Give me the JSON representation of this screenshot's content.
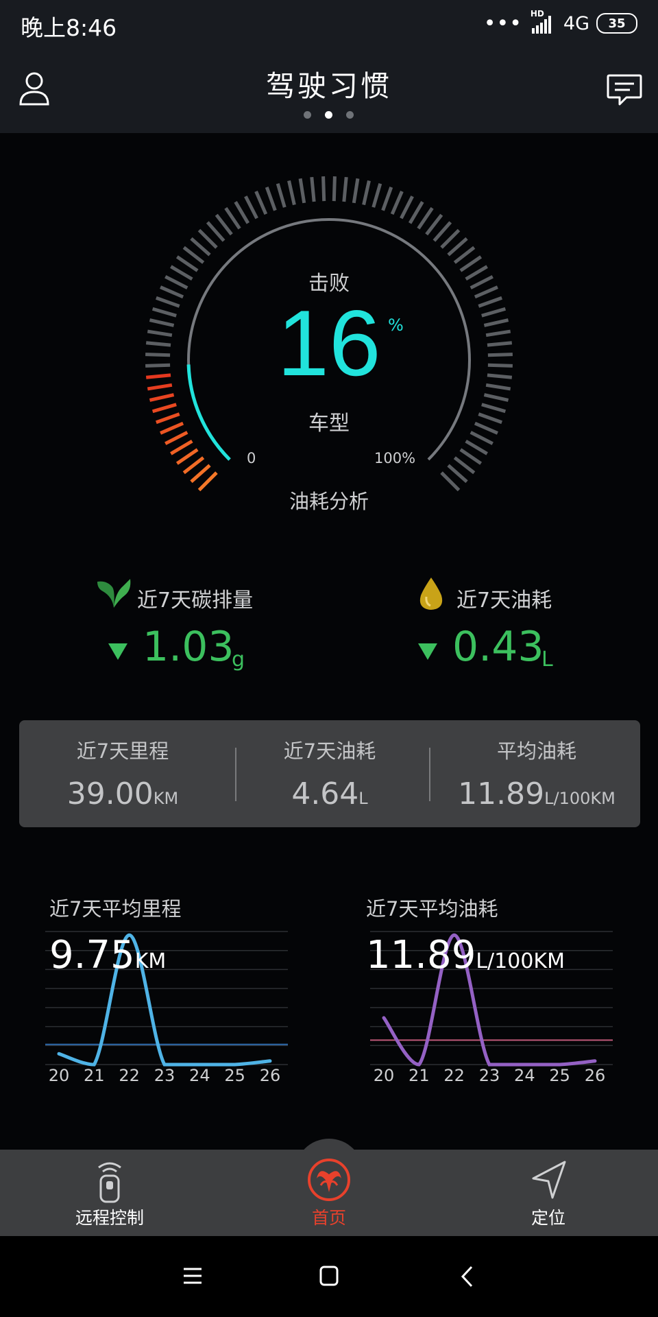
{
  "status_bar": {
    "time": "晚上8:46",
    "hd": "HD",
    "network": "4G",
    "battery": "35"
  },
  "header": {
    "title": "驾驶习惯",
    "pager_active_index": 1,
    "pager_count": 3
  },
  "gauge": {
    "top_label": "击败",
    "value": "16",
    "unit": "%",
    "bottom_label": "车型",
    "min_label": "0",
    "max_label": "100%",
    "caption": "油耗分析",
    "percent": 16
  },
  "stats": {
    "carbon": {
      "label": "近7天碳排量",
      "value": "1.03",
      "unit": "g",
      "icon": "leaf-icon"
    },
    "fuel": {
      "label": "近7天油耗",
      "value": "0.43",
      "unit": "L",
      "icon": "oil-drop-icon"
    }
  },
  "summary": {
    "mileage": {
      "label": "近7天里程",
      "value": "39.00",
      "unit": "KM"
    },
    "fuel": {
      "label": "近7天油耗",
      "value": "4.64",
      "unit": "L"
    },
    "avg": {
      "label": "平均油耗",
      "value": "11.89",
      "unit": "L/100KM"
    }
  },
  "chart_data": [
    {
      "type": "line",
      "title": "近7天平均里程",
      "headline_value": "9.75",
      "headline_unit": "KM",
      "categories": [
        "20",
        "21",
        "22",
        "23",
        "24",
        "25",
        "26"
      ],
      "values": [
        3,
        0,
        36,
        0,
        0,
        0,
        1
      ],
      "average_line": 5.6,
      "ylim": [
        0,
        37
      ],
      "color": "#4fb3e6",
      "avg_color": "#2d6bb0"
    },
    {
      "type": "line",
      "title": "近7天平均油耗",
      "headline_value": "11.89",
      "headline_unit": "L/100KM",
      "categories": [
        "20",
        "21",
        "22",
        "23",
        "24",
        "25",
        "26"
      ],
      "values": [
        13,
        0,
        36,
        0,
        0,
        0,
        1
      ],
      "average_line": 6.8,
      "ylim": [
        0,
        37
      ],
      "color": "#9461c4",
      "avg_color": "#c05a7a"
    }
  ],
  "bottom_nav": {
    "remote": "远程控制",
    "home": "首页",
    "locate": "定位"
  },
  "colors": {
    "accent_cyan": "#21e3dc",
    "green": "#3cc05e",
    "home_red": "#e8412c"
  }
}
